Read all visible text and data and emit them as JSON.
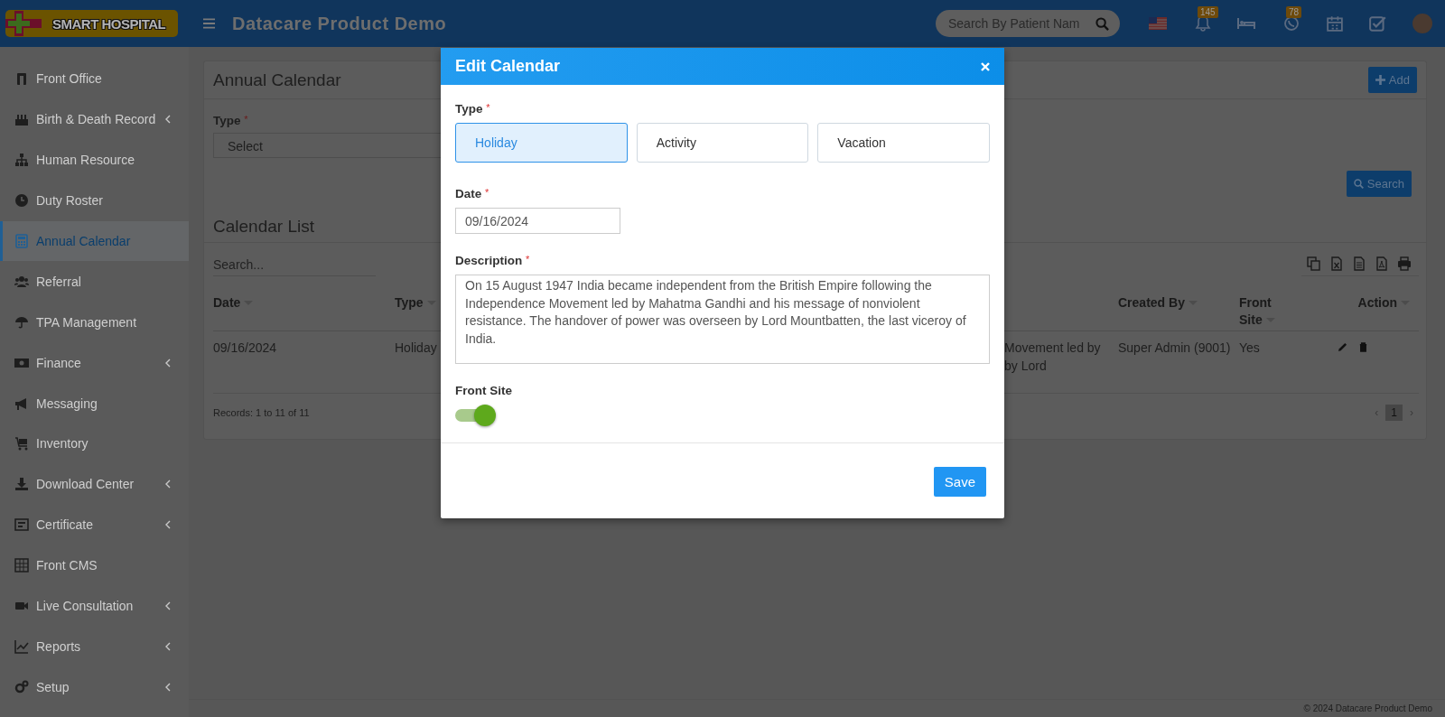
{
  "header": {
    "logo_text": "SMART HOSPITAL",
    "title": "Datacare Product Demo",
    "search": {
      "placeholder": "Search By Patient Nam"
    },
    "notification_count": "145",
    "message_count": "78"
  },
  "sidebar": {
    "items": [
      {
        "label": "Front Office",
        "selected": false,
        "has_submenu": false
      },
      {
        "label": "Birth & Death Record",
        "selected": false,
        "has_submenu": true
      },
      {
        "label": "Human Resource",
        "selected": false,
        "has_submenu": false
      },
      {
        "label": "Duty Roster",
        "selected": false,
        "has_submenu": false
      },
      {
        "label": "Annual Calendar",
        "selected": true,
        "has_submenu": false
      },
      {
        "label": "Referral",
        "selected": false,
        "has_submenu": false
      },
      {
        "label": "TPA Management",
        "selected": false,
        "has_submenu": false
      },
      {
        "label": "Finance",
        "selected": false,
        "has_submenu": true
      },
      {
        "label": "Messaging",
        "selected": false,
        "has_submenu": false
      },
      {
        "label": "Inventory",
        "selected": false,
        "has_submenu": false
      },
      {
        "label": "Download Center",
        "selected": false,
        "has_submenu": true
      },
      {
        "label": "Certificate",
        "selected": false,
        "has_submenu": true
      },
      {
        "label": "Front CMS",
        "selected": false,
        "has_submenu": false
      },
      {
        "label": "Live Consultation",
        "selected": false,
        "has_submenu": true
      },
      {
        "label": "Reports",
        "selected": false,
        "has_submenu": true
      },
      {
        "label": "Setup",
        "selected": false,
        "has_submenu": true
      }
    ]
  },
  "panel": {
    "title": "Annual Calendar",
    "add_button": "Add",
    "type_label": "Type",
    "required_mark": "*",
    "type_select": {
      "value": "Select"
    },
    "search_button": "Search"
  },
  "calendar_list": {
    "title": "Calendar List",
    "search": {
      "placeholder": "Search..."
    },
    "columns": [
      {
        "label": "Date"
      },
      {
        "label": "Type"
      },
      {
        "label": "Created By"
      },
      {
        "label": "Front Site"
      },
      {
        "label": "Action"
      }
    ],
    "rows": [
      {
        "date": "09/16/2024",
        "type": "Holiday",
        "column_3": "Movement led by\nby Lord",
        "created_by": "Super Admin (9001)",
        "front_site": "Yes"
      }
    ],
    "records": "Records: 1 to 11 of 11",
    "pagination": {
      "prev": "‹",
      "pages": [
        {
          "label": "1",
          "selected": true
        }
      ],
      "next": "›"
    }
  },
  "modal": {
    "title": "Edit Calendar",
    "type": {
      "label": "Type",
      "required_mark": "*",
      "options": [
        {
          "label": "Holiday",
          "selected": true
        },
        {
          "label": "Activity",
          "selected": false
        },
        {
          "label": "Vacation",
          "selected": false
        }
      ]
    },
    "date": {
      "label": "Date",
      "required_mark": "*",
      "value": "09/16/2024"
    },
    "description": {
      "label": "Description",
      "required_mark": "*",
      "value": "On 15 August 1947 India became independent from the British Empire following the Independence Movement led by Mahatma Gandhi and his message of nonviolent resistance. The handover of power was overseen by Lord Mountbatten, the last viceroy of India."
    },
    "front_site": {
      "label": "Front Site",
      "on": true
    },
    "save_button": "Save"
  },
  "footer": {
    "text": "© 2024 Datacare Product Demo"
  }
}
